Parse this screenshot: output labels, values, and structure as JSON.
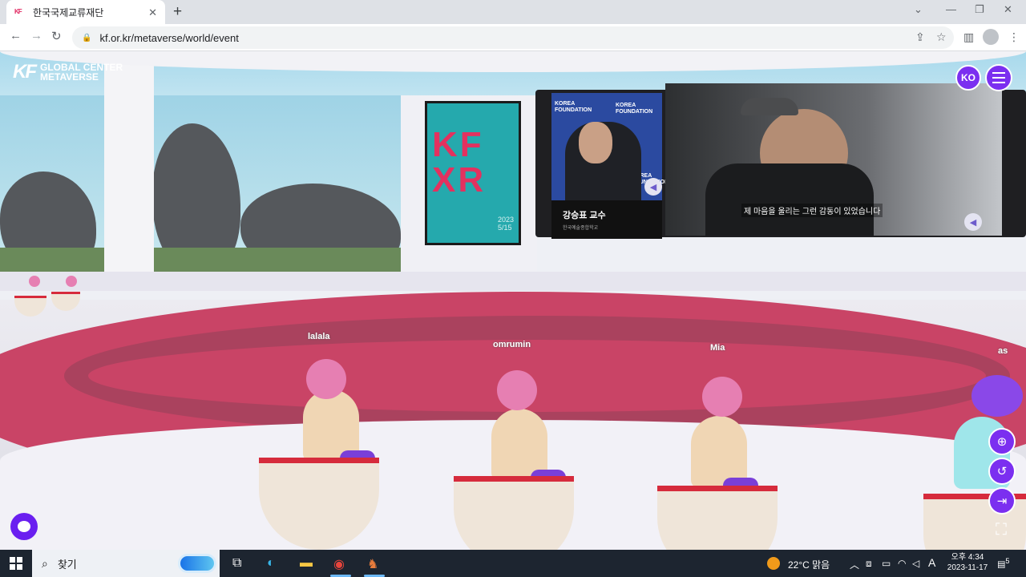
{
  "browser": {
    "tab_title": "한국국제교류재단",
    "tab_favicon": "KF",
    "url": "kf.or.kr/metaverse/world/event",
    "icons": [
      "back-icon",
      "forward-icon",
      "reload-icon",
      "lock-icon",
      "share-icon",
      "star-icon",
      "sidepanel-icon",
      "profile-icon",
      "kebab-icon"
    ]
  },
  "app": {
    "logo_mark": "KF",
    "logo_line1": "GLOBAL CENTER",
    "logo_line2": "METAVERSE",
    "lang_button": "KO",
    "accent": "#7b2ff0"
  },
  "screen": {
    "caption_name": "강승표 교수",
    "caption_sub": "한국예술종합학교",
    "subtitle": "제 마음을 울리는 그런 감동이 있었습니다",
    "backdrop_words": [
      "KOREA",
      "FOUNDATION",
      "KOREA",
      "FOUNDATION",
      "KOREA",
      "FOUNDATION"
    ]
  },
  "poster": {
    "title": "KF XR",
    "date": "2023 5/15"
  },
  "avatars": [
    {
      "name": "lalala"
    },
    {
      "name": "omrumin"
    },
    {
      "name": "Mia"
    },
    {
      "name": "as"
    }
  ],
  "controls": {
    "zoom": "⊕",
    "reset": "↺",
    "exit": "⇥",
    "fullscreen": "⛶"
  },
  "taskbar": {
    "search_placeholder": "찾기",
    "weather": "22°C 맑음",
    "time_ampm": "오후 4:34",
    "date": "2023-11-17",
    "ime": "A",
    "notifications": "5"
  }
}
